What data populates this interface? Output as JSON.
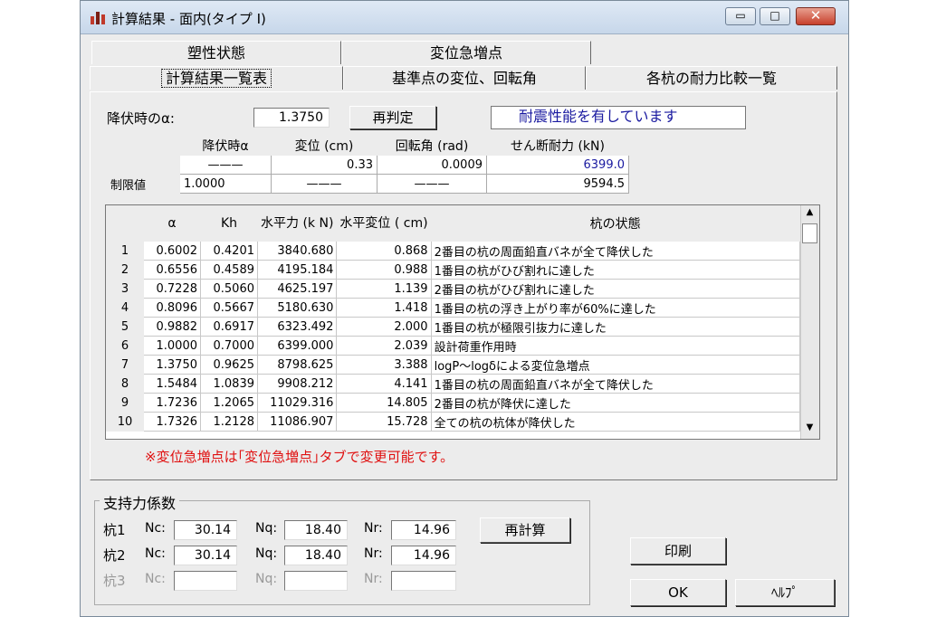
{
  "window": {
    "title": "計算結果 - 面内(タイプ I)",
    "min_glyph": "▭",
    "max_glyph": "□",
    "close_glyph": "✕"
  },
  "tabs": {
    "row1": [
      "塑性状態",
      "変位急増点"
    ],
    "row2": [
      "計算結果一覧表",
      "基準点の変位、回転角",
      "各杭の耐力比較一覧"
    ],
    "active": "計算結果一覧表"
  },
  "yield": {
    "label": "降伏時のα:",
    "value": "1.3750",
    "rejudge_button": "再判定",
    "status": "耐震性能を有しています"
  },
  "summary": {
    "headers": [
      "降伏時α",
      "変位 (cm)",
      "回転角 (rad)",
      "せん断耐力 (kN)"
    ],
    "row1": {
      "label": "",
      "alpha": "———",
      "disp": "0.33",
      "rot": "0.0009",
      "shear": "6399.0"
    },
    "row2": {
      "label": "制限値",
      "alpha": "1.0000",
      "disp": "———",
      "rot": "———",
      "shear": "9594.5"
    }
  },
  "grid": {
    "headers": [
      "α",
      "Kh",
      "水平力 (k N)",
      "水平変位 ( cm)",
      "杭の状態"
    ],
    "rows": [
      [
        "1",
        "0.6002",
        "0.4201",
        "3840.680",
        "0.868",
        "2番目の杭の周面鉛直バネが全て降伏した"
      ],
      [
        "2",
        "0.6556",
        "0.4589",
        "4195.184",
        "0.988",
        "1番目の杭がひび割れに達した"
      ],
      [
        "3",
        "0.7228",
        "0.5060",
        "4625.197",
        "1.139",
        "2番目の杭がひび割れに達した"
      ],
      [
        "4",
        "0.8096",
        "0.5667",
        "5180.630",
        "1.418",
        "1番目の杭の浮き上がり率が60%に達した"
      ],
      [
        "5",
        "0.9882",
        "0.6917",
        "6323.492",
        "2.000",
        "1番目の杭が極限引抜力に達した"
      ],
      [
        "6",
        "1.0000",
        "0.7000",
        "6399.000",
        "2.039",
        "設計荷重作用時"
      ],
      [
        "7",
        "1.3750",
        "0.9625",
        "8798.625",
        "3.388",
        "logP～logδによる変位急増点"
      ],
      [
        "8",
        "1.5484",
        "1.0839",
        "9908.212",
        "4.141",
        "1番目の杭の周面鉛直バネが全て降伏した"
      ],
      [
        "9",
        "1.7236",
        "1.2065",
        "11029.316",
        "14.805",
        "2番目の杭が降伏に達した"
      ],
      [
        "10",
        "1.7326",
        "1.2128",
        "11086.907",
        "15.728",
        "全ての杭の杭体が降伏した"
      ]
    ]
  },
  "note": "※変位急増点は｢変位急増点｣タブで変更可能です。",
  "bearing": {
    "title": "支持力係数",
    "recalc_button": "再計算",
    "nc_label": "Nc:",
    "nq_label": "Nq:",
    "nr_label": "Nr:",
    "piles": [
      {
        "label": "杭1",
        "nc": "30.14",
        "nq": "18.40",
        "nr": "14.96"
      },
      {
        "label": "杭2",
        "nc": "30.14",
        "nq": "18.40",
        "nr": "14.96"
      },
      {
        "label": "杭3",
        "nc": "",
        "nq": "",
        "nr": ""
      }
    ]
  },
  "buttons": {
    "print": "印刷",
    "ok": "OK",
    "help": "ﾍﾙﾌﾟ"
  },
  "colors": {
    "status_text": "#1a1aa0",
    "note_text": "#e01010",
    "shear_highlight": "#1a1aa0"
  }
}
